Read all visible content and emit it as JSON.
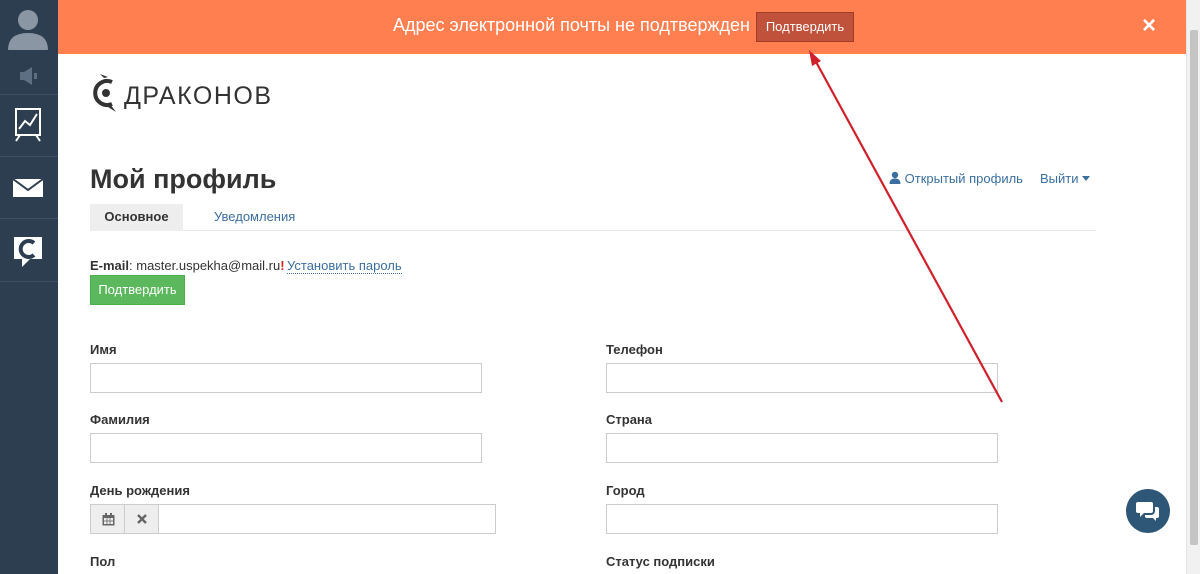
{
  "banner": {
    "message": "Адрес электронной почты не подтвержден",
    "confirm_label": "Подтвердить",
    "close_label": "×"
  },
  "brand": {
    "name": "ДРАКОНОВ"
  },
  "page": {
    "title": "Мой профиль",
    "open_profile_label": "Открытый профиль",
    "logout_label": "Выйти"
  },
  "tabs": [
    {
      "label": "Основное",
      "active": true
    },
    {
      "label": "Уведомления",
      "active": false
    }
  ],
  "email": {
    "label": "E-mail",
    "value": ": master.uspekha@mail.ru",
    "warning": "!",
    "set_password_label": "Установить пароль",
    "confirm_label": "Подтвердить"
  },
  "form": {
    "first_name_label": "Имя",
    "last_name_label": "Фамилия",
    "birthday_label": "День рождения",
    "gender_label": "Пол",
    "phone_label": "Телефон",
    "country_label": "Страна",
    "city_label": "Город",
    "subscription_label": "Статус подписки"
  },
  "icons": {
    "sidebar": [
      "user-avatar-icon",
      "megaphone-icon",
      "chart-icon",
      "mail-icon",
      "brand-icon"
    ],
    "calendar": "calendar-icon",
    "clear": "clear-icon",
    "chat": "chat-icon"
  },
  "colors": {
    "banner_bg": "#ff7f50",
    "banner_button": "#c0513a",
    "sidebar_bg": "#2d3e50",
    "confirm_green": "#5cb85c",
    "link": "#3b6fa0",
    "annotation_arrow": "#d0202a"
  }
}
